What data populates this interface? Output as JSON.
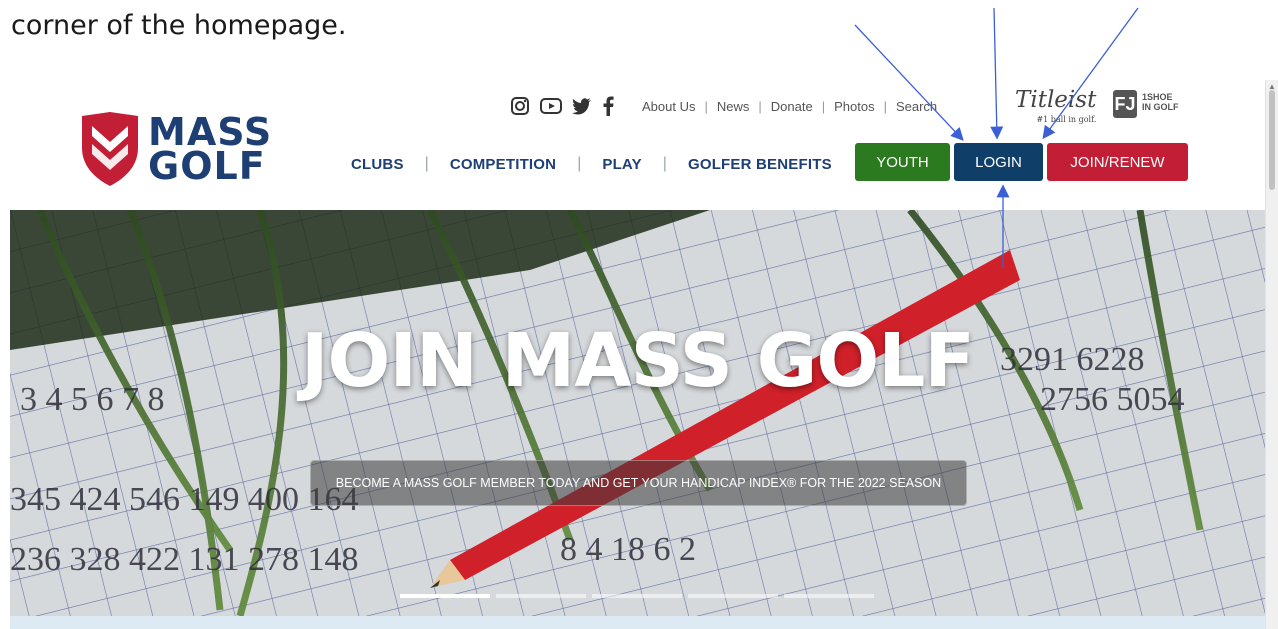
{
  "caption": "corner of the homepage.",
  "logo": {
    "text_line1": "MASS",
    "text_line2": "GOLF",
    "color": "#1e3f74",
    "shield_color": "#c21e35"
  },
  "utility": {
    "icons": [
      "instagram-icon",
      "youtube-icon",
      "twitter-icon",
      "facebook-icon"
    ],
    "links": [
      "About Us",
      "News",
      "Donate",
      "Photos",
      "Search"
    ]
  },
  "sponsors": {
    "titleist": "Titleist",
    "titleist_tag": "#1 ball in golf.",
    "fj": "FJ",
    "shoe_1": "1SHOE",
    "shoe_2": "IN GOLF"
  },
  "nav": {
    "items": [
      "CLUBS",
      "COMPETITION",
      "PLAY",
      "GOLFER BENEFITS"
    ],
    "youth": "YOUTH",
    "login": "LOGIN",
    "join": "JOIN/RENEW"
  },
  "hero": {
    "title": "JOIN MASS GOLF",
    "subtitle": "BECOME A MASS GOLF MEMBER TODAY AND GET YOUR HANDICAP INDEX® FOR THE 2022 SEASON",
    "slides_count": 5,
    "active_slide": 1
  },
  "colors": {
    "youth": "#2b7a1f",
    "login": "#0f3f68",
    "join": "#c21e35",
    "annotation": "#3b5fd6"
  }
}
